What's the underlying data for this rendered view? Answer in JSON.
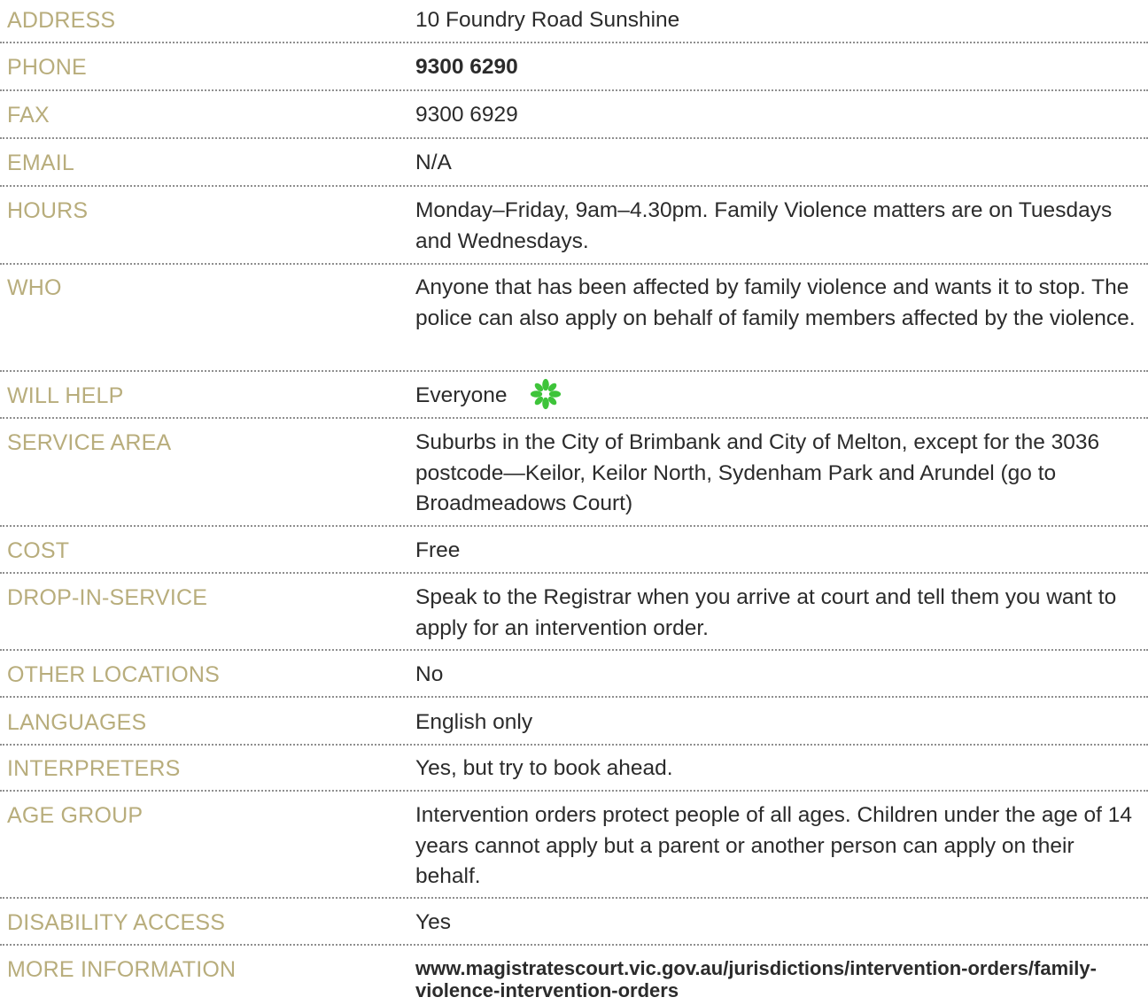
{
  "rows": [
    {
      "label": "ADDRESS",
      "value": "10 Foundry Road Sunshine"
    },
    {
      "label": "PHONE",
      "value": "9300 6290"
    },
    {
      "label": "FAX",
      "value": "9300 6929"
    },
    {
      "label": "EMAIL",
      "value": "N/A"
    },
    {
      "label": "HOURS",
      "value": "Monday–Friday, 9am–4.30pm. Family Violence matters are on Tuesdays and Wednesdays."
    },
    {
      "label": "WHO",
      "value": "Anyone that has been affected by family violence and wants it to stop. The police can also apply on behalf of family members affected by the violence."
    },
    {
      "label": "WILL HELP",
      "value": "Everyone"
    },
    {
      "label": "SERVICE AREA",
      "value": "Suburbs in the City of Brimbank and City of Melton, except for the 3036 postcode—Keilor, Keilor North, Sydenham Park and Arundel (go to Broadmeadows Court)"
    },
    {
      "label": "COST",
      "value": "Free"
    },
    {
      "label": "DROP-IN-SERVICE",
      "value": "Speak to the Registrar when you arrive at court and tell them you want to apply for an intervention order."
    },
    {
      "label": "OTHER LOCATIONS",
      "value": "No"
    },
    {
      "label": "LANGUAGES",
      "value": "English only"
    },
    {
      "label": "INTERPRETERS",
      "value": "Yes, but try to book ahead."
    },
    {
      "label": "AGE GROUP",
      "value": "Intervention orders protect people of all ages. Children under the age of 14 years cannot apply but a parent or another person can apply on their behalf."
    },
    {
      "label": "DISABILITY ACCESS",
      "value": "Yes"
    },
    {
      "label": "MORE INFORMATION",
      "value": "www.magistratescourt.vic.gov.au/jurisdictions/intervention-orders/family-violence-intervention-orders"
    }
  ],
  "icons": {
    "will_help": "asterisk-flower-icon"
  },
  "colors": {
    "label": "#b8ad7c",
    "value": "#2b2b2b",
    "icon": "#3ec43a",
    "divider": "#8f8f8f"
  }
}
